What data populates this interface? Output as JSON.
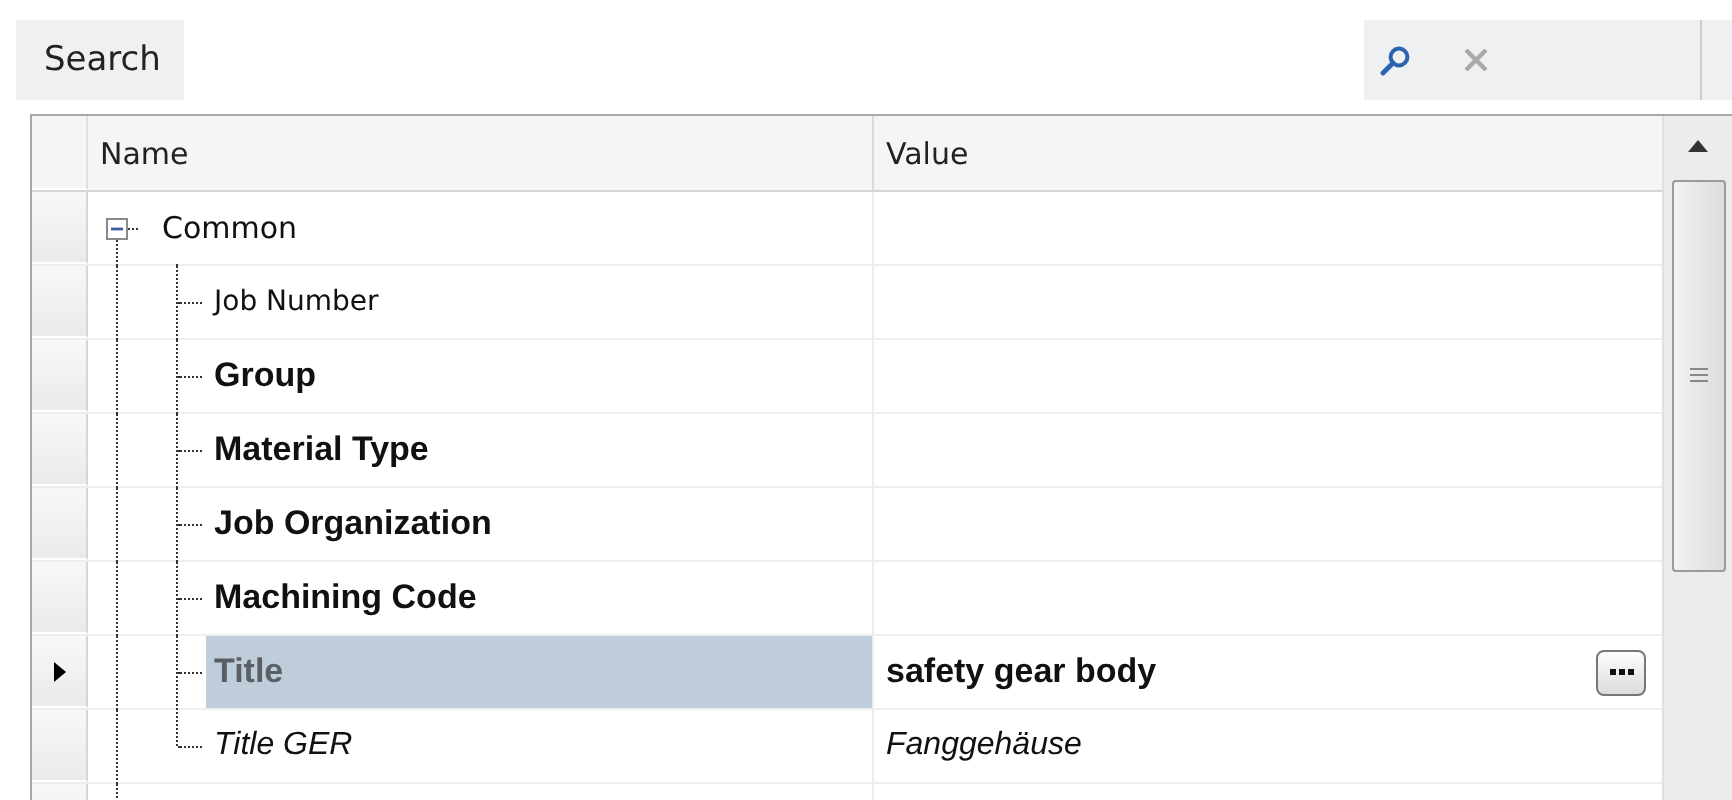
{
  "search": {
    "label": "Search"
  },
  "grid": {
    "columns": [
      "Name",
      "Value"
    ],
    "rows": [
      {
        "name": "Common",
        "kind": "category",
        "expanded": true,
        "selected": false,
        "children": [
          {
            "name": "Job Number",
            "kind": "plain",
            "selected": false
          },
          {
            "name": "Group",
            "kind": "bold",
            "selected": false
          },
          {
            "name": "Material Type",
            "kind": "bold",
            "selected": false
          },
          {
            "name": "Job Organization",
            "kind": "bold",
            "selected": false
          },
          {
            "name": "Machining Code",
            "kind": "bold",
            "selected": false
          },
          {
            "name": "Title",
            "kind": "bold",
            "selected": true,
            "value": "safety gear body"
          },
          {
            "name": "Title GER",
            "kind": "italic",
            "selected": false,
            "value": "Fanggehäuse"
          }
        ]
      }
    ]
  }
}
